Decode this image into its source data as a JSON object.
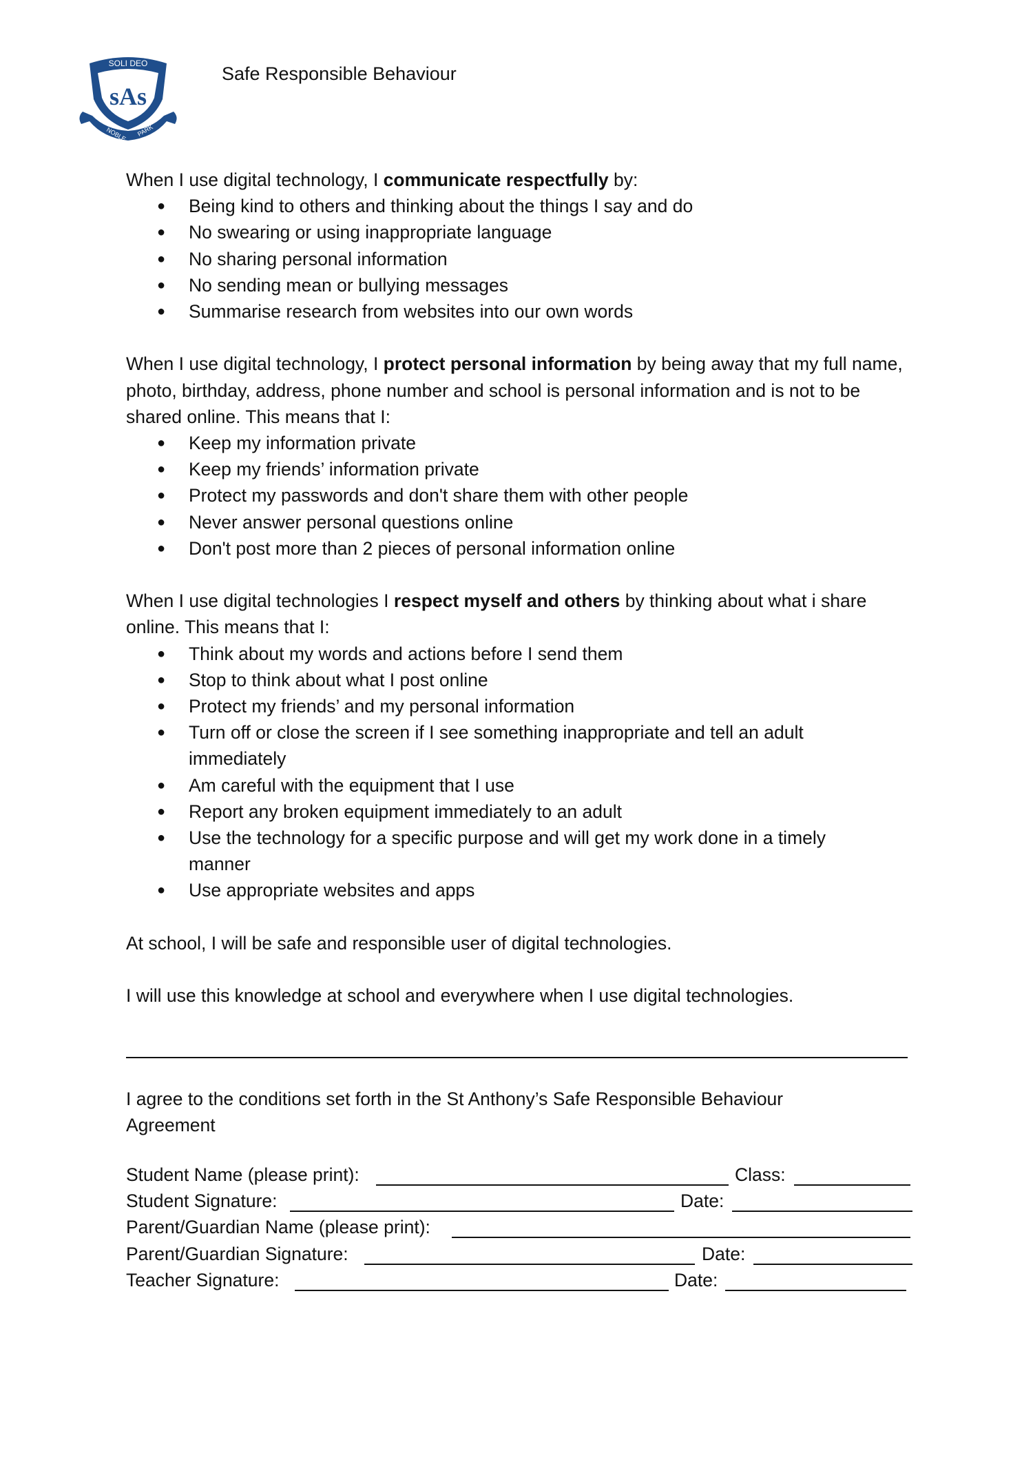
{
  "header": {
    "title": "Safe Responsible Behaviour",
    "logo": {
      "top_text": "SOLI DEO",
      "initials": "sAs",
      "ribbon_left": "NOBLE",
      "ribbon_right": "PARK",
      "color": "#1f4e8c"
    }
  },
  "sections": [
    {
      "pre": "When I use digital technology, I ",
      "bold": "communicate respectfully",
      "post": " by:",
      "items": [
        "Being kind to others and thinking about the things I say and do",
        "No swearing or using inappropriate language",
        "No sharing personal information",
        "No sending mean or bullying messages",
        "Summarise research from websites into our own words"
      ]
    },
    {
      "pre": "When I use digital technology, I ",
      "bold": "protect personal information",
      "post": " by being away that my full name, photo, birthday, address, phone number and school is personal information and is not to be shared online. This means that I:",
      "items": [
        "Keep my information private",
        "Keep my friends’ information private",
        "Protect my passwords and don't share them with other people",
        "Never answer personal questions online",
        "Don't post more than 2 pieces of personal information online"
      ]
    },
    {
      "pre": "When I use digital technologies I ",
      "bold": "respect myself and others",
      "post": " by thinking about what i share online. This means that I:",
      "items": [
        "Think about my words and actions before I send them",
        "Stop to think about what I post online",
        "Protect my friends’ and my personal information",
        "Turn off or close the screen if I see something inappropriate and tell an adult immediately",
        "Am careful with the equipment that I use",
        "Report any broken equipment immediately to an adult",
        "Use the technology for a specific purpose and will get my work done in a timely manner",
        "Use appropriate websites and apps"
      ]
    }
  ],
  "closing": [
    "At school, I will be safe and responsible user of digital technologies.",
    "I will use this knowledge at school and everywhere when I use digital technologies."
  ],
  "agreement": "I agree to the conditions set forth in the St Anthony’s Safe Responsible Behaviour Agreement",
  "form": {
    "student_name": "Student Name (please print):",
    "class": "Class:",
    "student_signature": "Student Signature:",
    "date": "Date:",
    "parent_name": "Parent/Guardian Name (please print):",
    "parent_signature": "Parent/Guardian Signature:",
    "teacher_signature": "Teacher Signature:"
  }
}
